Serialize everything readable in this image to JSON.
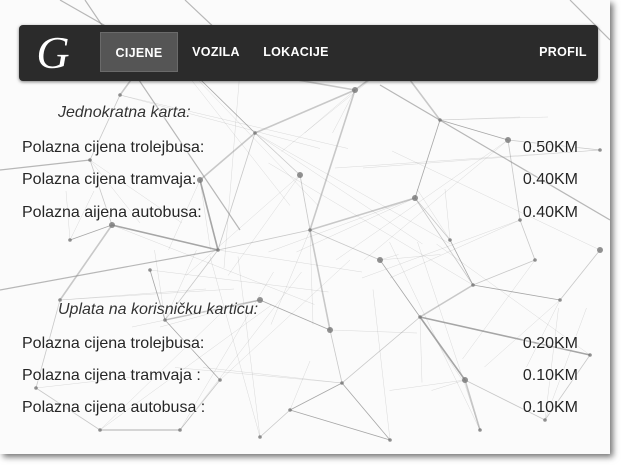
{
  "navbar": {
    "logo_letter": "G",
    "items": [
      {
        "label": "CIJENE",
        "active": true
      },
      {
        "label": "VOZILA",
        "active": false
      },
      {
        "label": "LOKACIJE",
        "active": false
      }
    ],
    "profile_label": "PROFIL"
  },
  "single_ticket": {
    "title": "Jednokratna karta:",
    "rows": [
      {
        "label": "Polazna cijena trolejbusa:",
        "price": "0.50KM"
      },
      {
        "label": "Polazna cijena tramvaja:",
        "price": "0.40KM"
      },
      {
        "label": "Polazna aijena autobusa:",
        "price": "0.40KM"
      }
    ]
  },
  "card_payment": {
    "title": "Uplata na korisničku karticu:",
    "rows": [
      {
        "label": "Polazna cijena trolejbusa:",
        "price": "0.20KM"
      },
      {
        "label": "Polazna cijena tramvaja :",
        "price": "0.10KM"
      },
      {
        "label": "Polazna cijena autobusa :",
        "price": "0.10KM"
      }
    ]
  },
  "colors": {
    "navbar": "#2b2b2b",
    "active_tab": "#555555",
    "text": "#262626"
  }
}
